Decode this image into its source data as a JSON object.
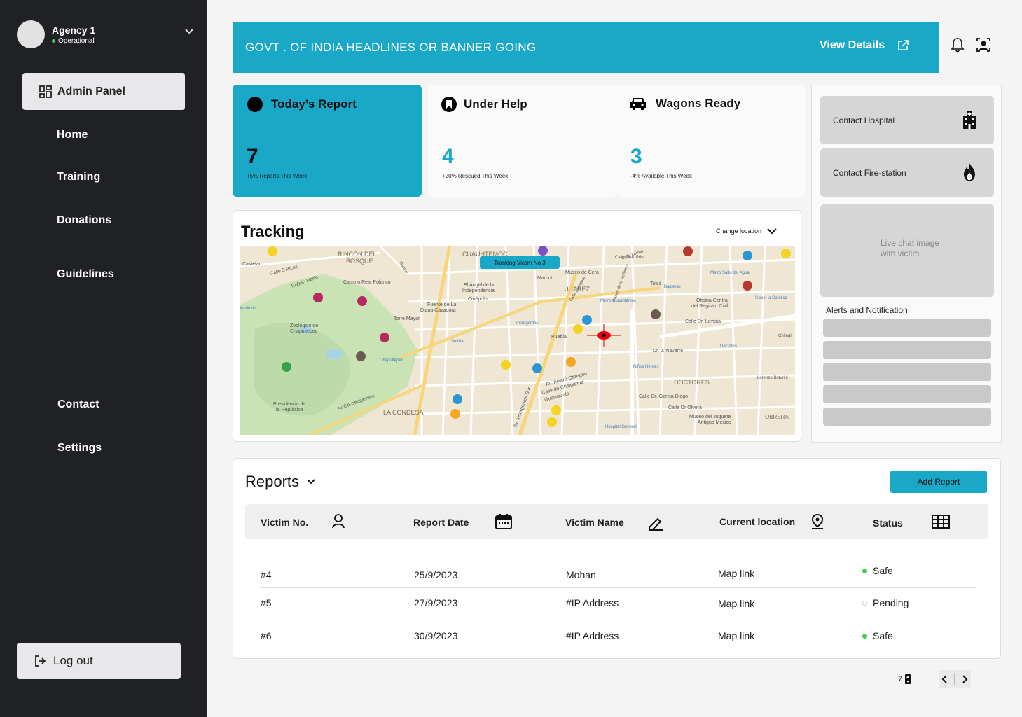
{
  "sidebar": {
    "agency_name": "Agency 1",
    "agency_status": "Operational",
    "admin_label": "Admin Panel",
    "nav": [
      "Home",
      "Training",
      "Donations",
      "Guidelines",
      "Contact",
      "Settings"
    ],
    "logout_label": "Log out"
  },
  "banner": {
    "text": "GOVT . OF INDIA HEADLINES OR BANNER GOING",
    "link": "View Details"
  },
  "cards": [
    {
      "title": "Today’s Report",
      "value": "7",
      "sub": "+5% Reports This Week",
      "icon": "dot-icon"
    },
    {
      "title": "Under Help",
      "value": "4",
      "sub": "+20% Rescued This Week",
      "icon": "bookmark-icon"
    },
    {
      "title": "Wagons Ready",
      "value": "3",
      "sub": "-4% Available This Week",
      "icon": "car-icon"
    }
  ],
  "right_panel": {
    "hospital": "Contact Hospital",
    "fire": "Contact Fire-station",
    "chat_line1": "Live chat image",
    "chat_line2": "with victim",
    "alerts_title": "Alerts and Notification"
  },
  "tracking": {
    "title": "Tracking",
    "change_location": "Change location",
    "map_tag": "Tracking Victim No.3",
    "labels": {
      "rincon": "RINCÓN DEL",
      "bosque": "BOSQUE",
      "cuauhtemoc": "CUAUHTÉMOC",
      "juarez": "JUÁREZ",
      "doctores": "DOCTORES",
      "condesa": "LA CONDESA",
      "obrera": "OBRERA",
      "polanco": "Camino Real Polanco",
      "zoologico1": "Zoológico de",
      "zoologico2": "Chapultepec",
      "torre": "Torre Mayor",
      "angel1": "El Ángel de la",
      "angel2": "Independencia",
      "cinepolis": "Cinépolis",
      "fuente1": "Fuente de La",
      "fuente2": "Diana Cazadora",
      "museo_cera": "Museo de Cera",
      "marriott": "Marriott",
      "oficina1": "Oficina Central",
      "oficina2": "del Registro Civil",
      "presidencia1": "Presidencia de",
      "presidencia2": "la República",
      "museo_juguete1": "Museo del Juguete",
      "museo_juguete2": "Antiguo México",
      "constituyentes": "Av Constituyentes",
      "insurgentes": "Av. Insurgentes Sur",
      "alvaro": "Av. Álvaro Obregón",
      "chihuahua": "Calle de Chihuahua",
      "guanajuato": "Guanajuato",
      "lavista": "Calle Dr. Lavista",
      "navarro": "Dr. J. Navarro",
      "garcia": "Calle Dr. García Diego",
      "olvera": "Calle Dr Olvera",
      "puebla": "Puebla",
      "tolsa": "Tolsá",
      "castelar": "Castelar",
      "picos": "Calle 3 Picos",
      "ruben": "Rubén Darío",
      "metro_cuauh": "Metro Cuauhtémoc",
      "metro_salto": "Metro Salto del Agua",
      "insurgentes_m": "Insurgentes",
      "sevilla": "Sevilla",
      "chapultepec_m": "Chapultepec",
      "ninos": "Niños Héroes",
      "hospital_gen": "Hospital General",
      "auditorio": "Auditorio",
      "doctores_m": "Doctores",
      "isabel": "Isabel la Católica",
      "balderas": "Balderas",
      "chimal": "Chimal",
      "lorenzo": "Lorenzo Boturini",
      "darwin": "Darwin",
      "lerma": "Calle Lerma",
      "liverpool": "Calle Liverpool",
      "reforma": "Paseo de la Reforma",
      "gral_prim": "Calle Gral. Prim"
    }
  },
  "reports": {
    "title": "Reports",
    "add_label": "Add Report",
    "columns": [
      "Victim No.",
      "Report Date",
      "Victim Name",
      "Current location",
      "Status"
    ],
    "rows": [
      {
        "no": "#4",
        "date": "25/9/2023",
        "name": "Mohan",
        "loc": "Map link",
        "status": "Safe"
      },
      {
        "no": "#5",
        "date": "27/9/2023",
        "name": "#IP Address",
        "loc": "Map link",
        "status": "Pending"
      },
      {
        "no": "#6",
        "date": "30/9/2023",
        "name": "#IP Address",
        "loc": "Map link",
        "status": "Safe"
      }
    ]
  },
  "pagination": {
    "per_page": "7"
  },
  "colors": {
    "accent": "#1aa8c9",
    "sidebar": "#202124",
    "safe": "#3fd14a",
    "pending": "#cfcfcf"
  }
}
